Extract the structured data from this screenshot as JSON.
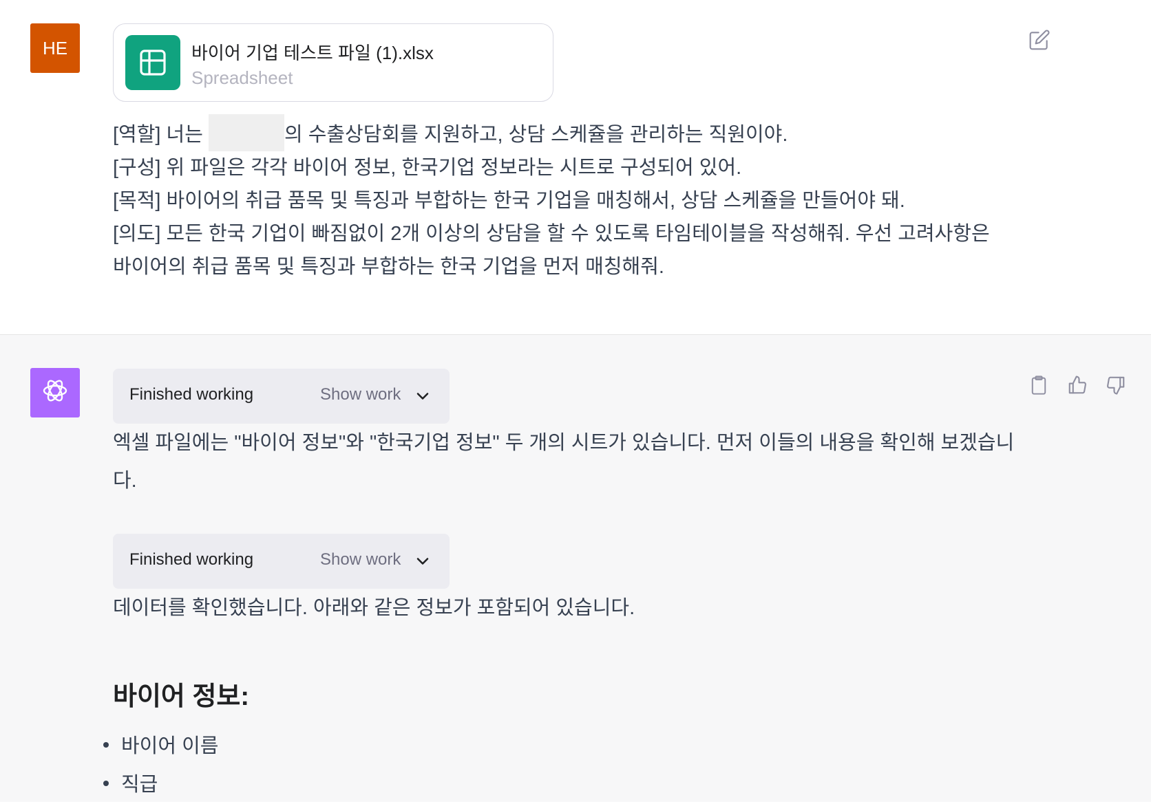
{
  "user": {
    "avatar_initials": "HE",
    "avatar_color": "#d35400",
    "file": {
      "name": "바이어 기업 테스트 파일 (1).xlsx",
      "type": "Spreadsheet",
      "icon": "spreadsheet-icon",
      "icon_color": "#10a37f"
    },
    "edit_icon": "edit-icon",
    "prompt_line1_before": "[역할] 너는 ",
    "prompt_line1_after": "의 수출상담회를 지원하고, 상담 스케쥴을 관리하는 직원이야.",
    "prompt_lines": [
      "[구성] 위 파일은 각각 바이어 정보, 한국기업 정보라는 시트로 구성되어 있어.",
      "[목적] 바이어의 취급 품목 및 특징과 부합하는 한국 기업을 매칭해서, 상담 스케쥴을 만들어야 돼.",
      "[의도] 모든 한국 기업이 빠짐없이 2개 이상의 상담을 할 수 있도록 타임테이블을 작성해줘. 우선 고려사항은",
      "바이어의 취급 품목 및 특징과 부합하는 한국 기업을 먼저 매칭해줘."
    ]
  },
  "assistant": {
    "avatar_icon": "openai-logo-icon",
    "avatar_color": "#ab68ff",
    "work_boxes": [
      {
        "status": "Finished working",
        "toggle": "Show work"
      },
      {
        "status": "Finished working",
        "toggle": "Show work"
      }
    ],
    "paragraph1": "엑셀 파일에는 \"바이어 정보\"와 \"한국기업 정보\" 두 개의 시트가 있습니다. 먼저 이들의 내용을 확인해 보겠습니다.",
    "paragraph2": "데이터를 확인했습니다. 아래와 같은 정보가 포함되어 있습니다.",
    "heading": "바이어 정보:",
    "bullets": [
      "바이어 이름",
      "직급"
    ],
    "actions": [
      "copy-icon",
      "thumbs-up-icon",
      "thumbs-down-icon"
    ]
  }
}
